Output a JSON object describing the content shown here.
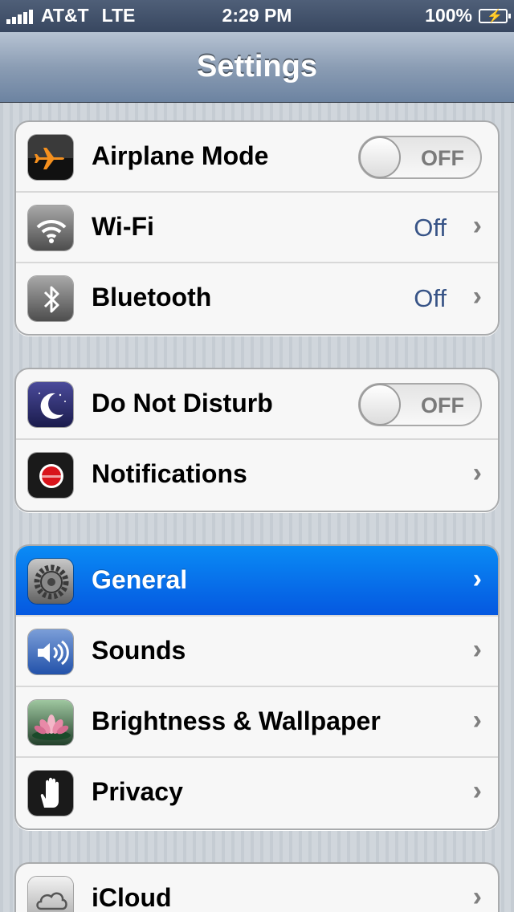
{
  "status_bar": {
    "carrier": "AT&T",
    "network": "LTE",
    "time": "2:29 PM",
    "battery": "100%"
  },
  "nav": {
    "title": "Settings"
  },
  "groups": [
    {
      "rows": [
        {
          "label": "Airplane Mode",
          "icon": "airplane-icon",
          "toggle": "OFF"
        },
        {
          "label": "Wi-Fi",
          "icon": "wifi-icon",
          "value": "Off"
        },
        {
          "label": "Bluetooth",
          "icon": "bluetooth-icon",
          "value": "Off"
        }
      ]
    },
    {
      "rows": [
        {
          "label": "Do Not Disturb",
          "icon": "moon-icon",
          "toggle": "OFF"
        },
        {
          "label": "Notifications",
          "icon": "notifications-icon"
        }
      ]
    },
    {
      "rows": [
        {
          "label": "General",
          "icon": "gear-icon",
          "selected": true
        },
        {
          "label": "Sounds",
          "icon": "speaker-icon"
        },
        {
          "label": "Brightness & Wallpaper",
          "icon": "flower-icon"
        },
        {
          "label": "Privacy",
          "icon": "hand-icon"
        }
      ]
    },
    {
      "rows": [
        {
          "label": "iCloud",
          "icon": "cloud-icon"
        }
      ]
    }
  ],
  "colors": {
    "selected_row": "#0a6ff0",
    "value_text": "#385487",
    "nav_bar": "#7f93ad"
  }
}
